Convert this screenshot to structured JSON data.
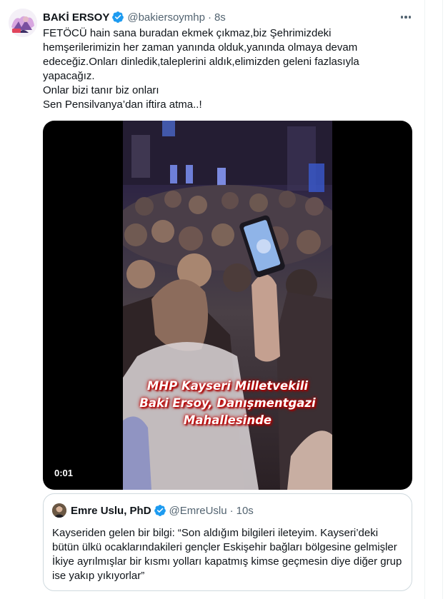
{
  "tweet": {
    "author_name": "BAKİ ERSOY",
    "author_handle": "@bakiersoymhp",
    "separator": "·",
    "time": "8s",
    "text": "FETÖCÜ hain sana buradan ekmek çıkmaz,biz Şehrimizdeki\nhemşerilerimizin her zaman yanında olduk,yanında olmaya devam\nedeceğiz.Onları dinledik,taleplerini aldık,elimizden geleni fazlasıyla\nyapacağız.\nOnlar bizi tanır biz onları\nSen Pensilvanya’dan iftira atma..!"
  },
  "media": {
    "caption_lines": [
      "MHP Kayseri Milletvekili",
      "Baki Ersoy, Danışmentgazi",
      "Mahallesinde"
    ],
    "video_time": "0:01"
  },
  "quoted_tweet": {
    "author_name": "Emre Uslu, PhD",
    "author_handle": "@EmreUslu",
    "separator": "·",
    "time": "10s",
    "text": "Kayseriden gelen bir bilgi: “Son aldığım bilgileri ileteyim. Kayseri’deki bütün ülkü ocaklarındakileri gençler Eskişehir bağları bölgesine gelmişler İkiye ayrılmışlar bir kısmı yolları kapatmış kimse geçmesin diye diğer grup ise yakıp yıkıyorlar”"
  },
  "icons": {
    "verified": "verified-badge-icon",
    "more": "more-options-icon"
  },
  "colors": {
    "verified_blue": "#1d9bf0",
    "secondary_text": "#536471",
    "border": "#cfd9de",
    "caption_glow": "#cc0000"
  }
}
